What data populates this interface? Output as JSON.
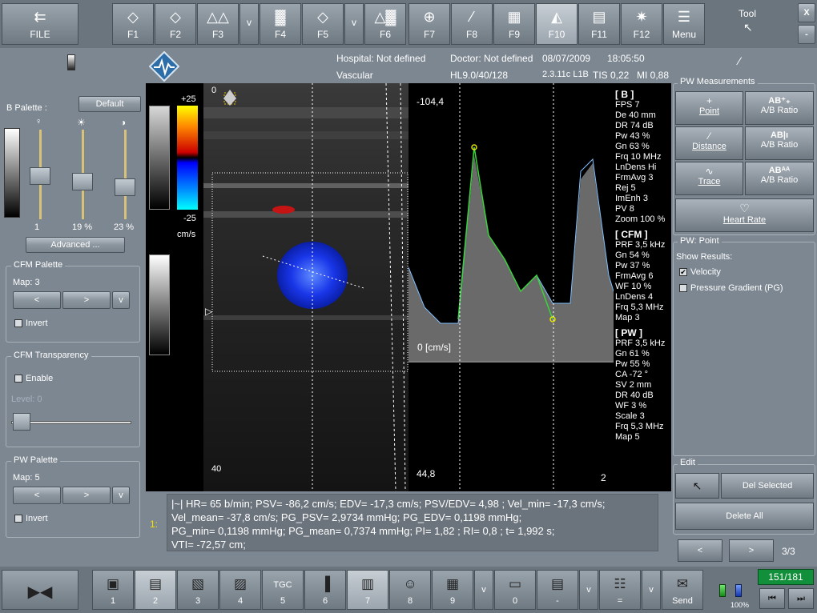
{
  "toolbar": {
    "file": "FILE",
    "f1": "F1",
    "f2": "F2",
    "f3": "F3",
    "v1": "v",
    "f4": "F4",
    "f5": "F5",
    "v2": "v",
    "f6": "F6",
    "f7": "F7",
    "f8": "F8",
    "f9": "F9",
    "f10": "F10",
    "f11": "F11",
    "f12": "F12",
    "menu": "Menu",
    "tool": "Tool",
    "close": "X",
    "minimize": "-"
  },
  "header": {
    "hospital": "Hospital: Not defined",
    "doctor": "Doctor: Not defined",
    "date": "08/07/2009",
    "time": "18:05:50",
    "exam": "Vascular",
    "probe": "HL9.0/40/128",
    "version": "2.3.11c L1B",
    "tis": "TIS 0,22",
    "mi": "MI 0,88"
  },
  "left": {
    "b_palette": "B Palette :",
    "default": "Default",
    "slider1_val": "1",
    "slider2_val": "19 %",
    "slider3_val": "23 %",
    "advanced": "Advanced ...",
    "cfm_palette_title": "CFM Palette",
    "cfm_map": "Map: 3",
    "prev": "<",
    "next": ">",
    "drop": "v",
    "invert": "Invert",
    "cfm_transp_title": "CFM Transparency",
    "enable": "Enable",
    "level": "Level: 0",
    "pw_palette_title": "PW Palette",
    "pw_map": "Map: 5"
  },
  "image": {
    "scale_top": "+25",
    "scale_bottom": "-25",
    "scale_unit": "cm/s",
    "depth_top": "0",
    "depth_bottom": "40",
    "pw_top": "-104,4",
    "pw_bottom": "44,8",
    "pw_baseline": "0 [cm/s]",
    "pw_page": "2"
  },
  "params": {
    "b_title": "[ B ]",
    "b": [
      "FPS 7",
      "De 40 mm",
      "DR 74 dB",
      "Pw 43 %",
      "Gn 63 %",
      "Frq 10 MHz",
      "LnDens Hi",
      "FrmAvg 3",
      "Rej 5",
      "ImEnh 3",
      "PV 8",
      "Zoom 100 %"
    ],
    "cfm_title": "[ CFM ]",
    "cfm": [
      "PRF 3,5 kHz",
      "Gn 54 %",
      "Pw 37 %",
      "FrmAvg 6",
      "WF 10 %",
      "LnDens 4",
      "Frq 5,3 MHz",
      "Map 3"
    ],
    "pw_title": "[ PW ]",
    "pw": [
      "PRF 3,5 kHz",
      "Gn 61 %",
      "Pw 55 %",
      "CA -72 °",
      "SV 2 mm",
      "DR 40 dB",
      "WF 3 %",
      "Scale 3",
      "Frq 5,3 MHz",
      "Map 5"
    ]
  },
  "results": {
    "index": "1:",
    "lines": [
      "|~| HR= 65 b/min; PSV= -86,2 cm/s; EDV= -17,3 cm/s; PSV/EDV= 4,98 ; Vel_min= -17,3 cm/s;",
      "Vel_mean= -37,8 cm/s; PG_PSV= 2,9734 mmHg; PG_EDV= 0,1198 mmHg;",
      "PG_min= 0,1198 mmHg; PG_mean= 0,7374 mmHg; PI= 1,82 ; RI= 0,8 ; t= 1,992 s;",
      "VTI= -72,57 cm;"
    ]
  },
  "right": {
    "pw_meas_title": "PW Measurements",
    "point": "Point",
    "ab_ratio": "A/B Ratio",
    "ab_icon1": "AB⁺₊",
    "ab_icon2": "AB|ı",
    "ab_icon3": "ABᴬᴬ",
    "distance": "Distance",
    "trace": "Trace",
    "heart_rate": "Heart Rate",
    "pw_point_title": "PW: Point",
    "show_results": "Show Results:",
    "velocity": "Velocity",
    "pressure_gradient": "Pressure Gradient (PG)",
    "edit_title": "Edit",
    "del_selected": "Del Selected",
    "delete_all": "Delete All",
    "prev": "<",
    "next": ">",
    "page": "3/3"
  },
  "bottom": {
    "b1": "1",
    "b2": "2",
    "b3": "3",
    "b4": "4",
    "b5": "5",
    "tgc": "TGC",
    "b6": "6",
    "b7": "7",
    "b8": "8",
    "b9": "9",
    "v": "v",
    "b0": "0",
    "dash": "-",
    "eq": "=",
    "send": "Send",
    "battery": "100%",
    "frame_counter": "151/181"
  }
}
